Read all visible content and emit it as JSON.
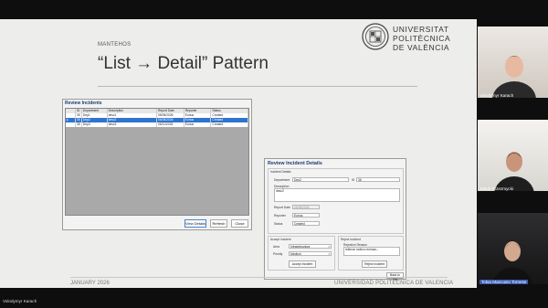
{
  "slide": {
    "section": "MANTEHOS",
    "title": "“List → Detail” Pattern",
    "logo_lines": [
      "UNIVERSITAT",
      "POLITÈCNICA",
      "DE VALÈNCIA"
    ],
    "footer_left": "JANUARY 2026",
    "footer_right": "UNIVERSIDAD POLITÉCNICA DE VALENCIA"
  },
  "review_incidents": {
    "title": "Review Incidents",
    "columns": [
      "",
      "ID",
      "Department",
      "Description",
      "Report Date",
      "Reporter",
      "Status"
    ],
    "rows": [
      {
        "marker": "",
        "id": "35",
        "department": "Dep1",
        "description": "desc1",
        "date": "05/05/2026",
        "reporter": "Eurius",
        "status": "Created",
        "selected": false
      },
      {
        "marker": "▸",
        "id": "36",
        "department": "Dep2",
        "description": "desc2",
        "date": "05/05/2026",
        "reporter": "Eurius",
        "status": "Created",
        "selected": true
      },
      {
        "marker": "",
        "id": "38",
        "department": "Dep3",
        "description": "desc3",
        "date": "05/11/2026",
        "reporter": "Eurius",
        "status": "Created",
        "selected": false
      }
    ],
    "buttons": {
      "view": "View Details",
      "refresh": "Refresh",
      "close": "Close"
    }
  },
  "incident_details": {
    "title": "Review Incident Details",
    "group_label": "Incident Details",
    "department_label": "Department",
    "department_value": "Dep2",
    "id_label": "ID",
    "id_value": "36",
    "description_label": "Description",
    "description_value": "desc2",
    "report_date_label": "Report Date",
    "report_date_value": "05/05/2026",
    "reporter_label": "Reporter",
    "reporter_value": "Eurius",
    "status_label": "Status",
    "status_value": "Created",
    "accept_group": "Accept Incident",
    "area_label": "Area",
    "area_value": "Infraestructura",
    "priority_label": "Priority",
    "priority_value": "Medium",
    "accept_button": "Accept Incident",
    "reject_group": "Reject Incident",
    "reason_label": "Rejection Reason",
    "reason_value": "rellenar motivo rechazo...",
    "reject_button": "Reject Incident",
    "back_button": "Back to List"
  },
  "participants": [
    {
      "name": "Volodymyr Karach"
    },
    {
      "name": "Jakub Przezmycki"
    },
    {
      "name": "Tobia Mancusio Tornese"
    }
  ],
  "self_label": "Volodymyr Karach"
}
